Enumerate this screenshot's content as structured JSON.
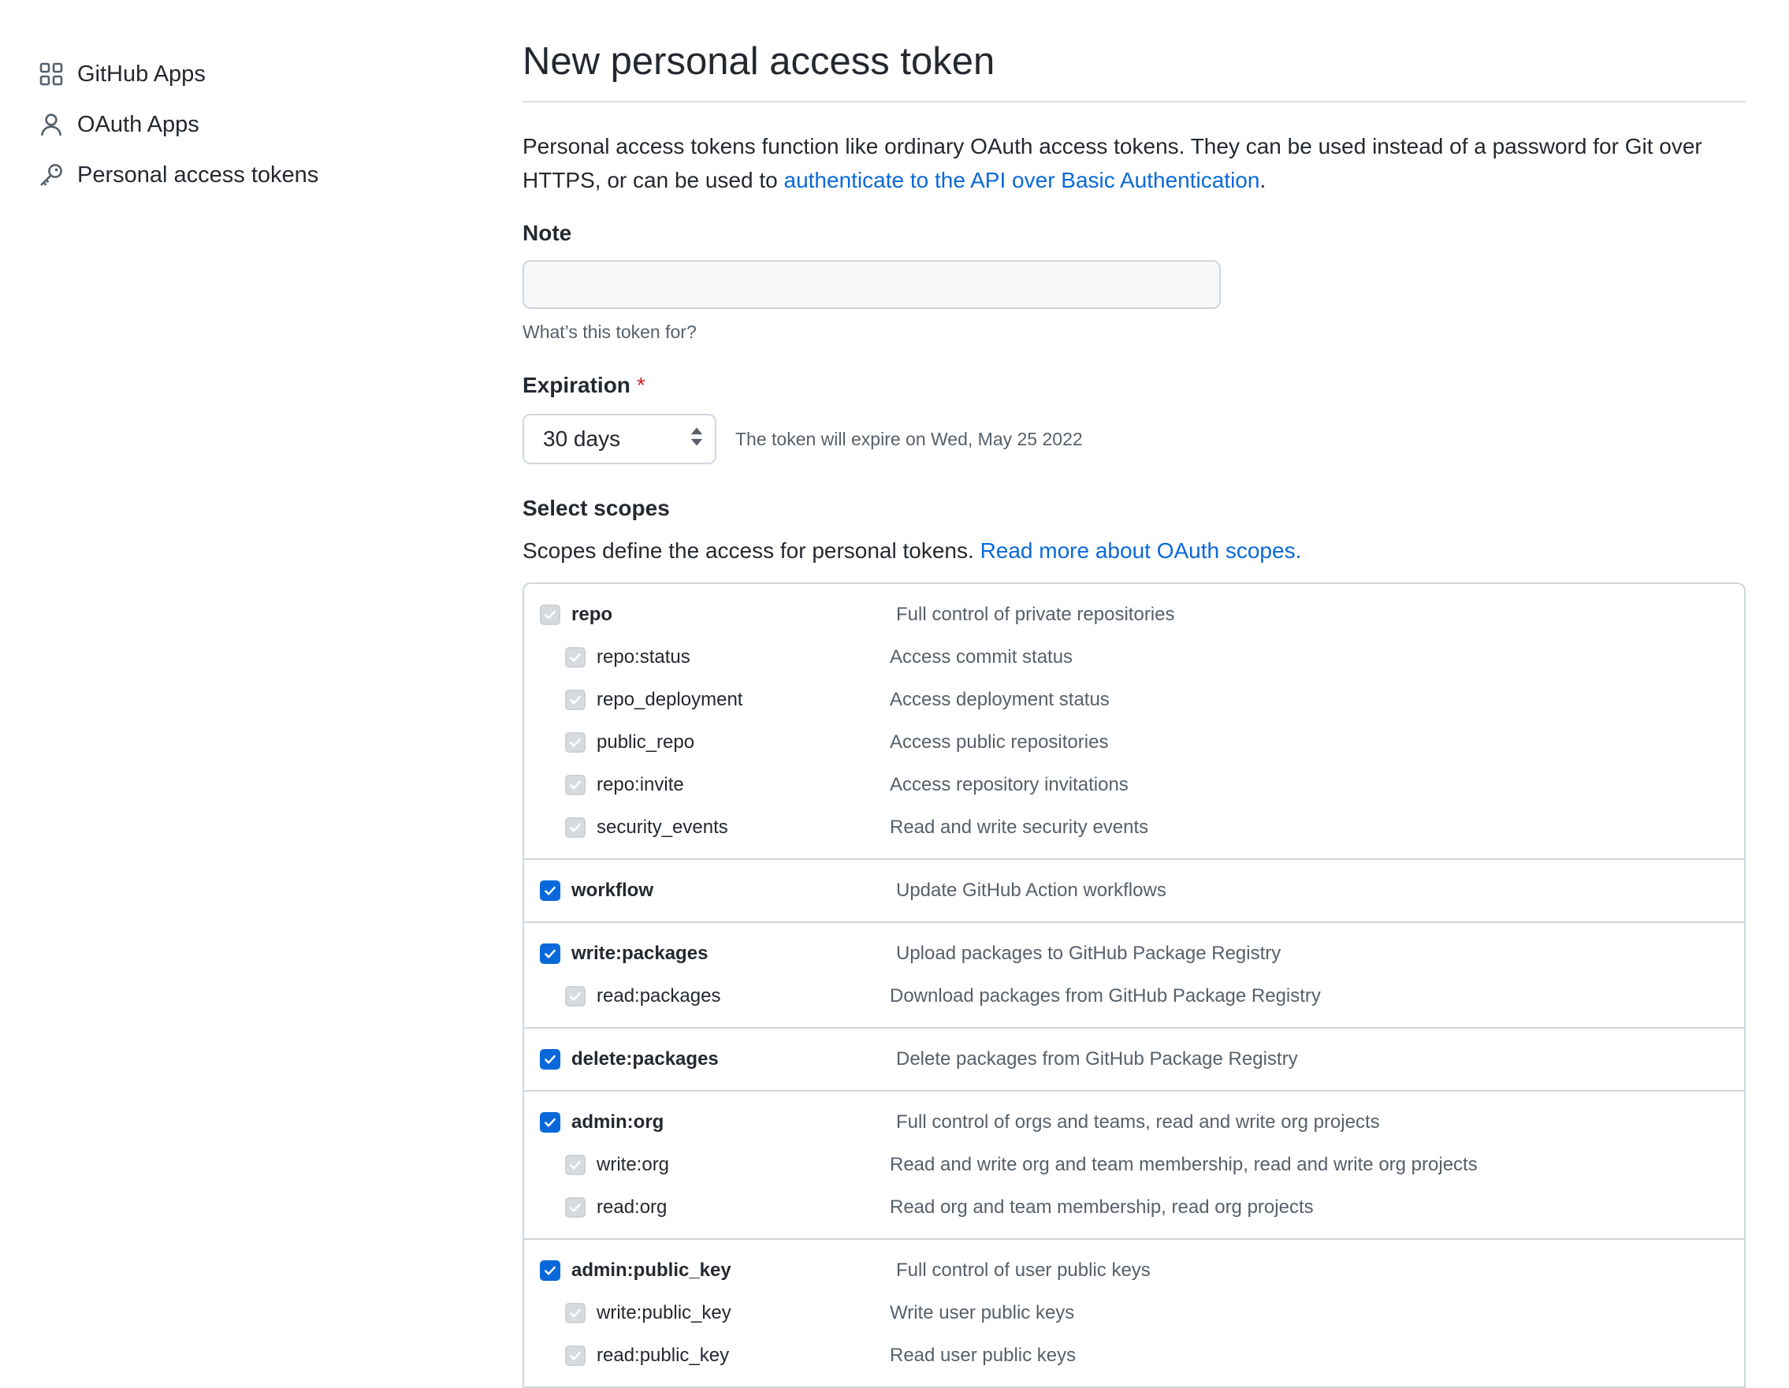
{
  "sidebar": {
    "items": [
      {
        "label": "GitHub Apps",
        "icon": "apps-grid-icon"
      },
      {
        "label": "OAuth Apps",
        "icon": "person-icon"
      },
      {
        "label": "Personal access tokens",
        "icon": "key-icon"
      }
    ]
  },
  "page": {
    "title": "New personal access token",
    "intro_text": "Personal access tokens function like ordinary OAuth access tokens. They can be used instead of a password for Git over HTTPS, or can be used to ",
    "intro_link": "authenticate to the API over Basic Authentication",
    "intro_end": "."
  },
  "note": {
    "label": "Note",
    "value": "",
    "help": "What’s this token for?"
  },
  "expiration": {
    "label": "Expiration",
    "required_mark": "*",
    "selected": "30 days",
    "info": "The token will expire on Wed, May 25 2022"
  },
  "scopes": {
    "label": "Select scopes",
    "desc": "Scopes define the access for personal tokens. ",
    "desc_link": "Read more about OAuth scopes.",
    "groups": [
      {
        "name": "repo",
        "desc": "Full control of private repositories",
        "checked": true,
        "disabled": true,
        "children": [
          {
            "name": "repo:status",
            "desc": "Access commit status"
          },
          {
            "name": "repo_deployment",
            "desc": "Access deployment status"
          },
          {
            "name": "public_repo",
            "desc": "Access public repositories"
          },
          {
            "name": "repo:invite",
            "desc": "Access repository invitations"
          },
          {
            "name": "security_events",
            "desc": "Read and write security events"
          }
        ]
      },
      {
        "name": "workflow",
        "desc": "Update GitHub Action workflows",
        "checked": true,
        "disabled": false,
        "children": []
      },
      {
        "name": "write:packages",
        "desc": "Upload packages to GitHub Package Registry",
        "checked": true,
        "disabled": false,
        "children": [
          {
            "name": "read:packages",
            "desc": "Download packages from GitHub Package Registry"
          }
        ]
      },
      {
        "name": "delete:packages",
        "desc": "Delete packages from GitHub Package Registry",
        "checked": true,
        "disabled": false,
        "children": []
      },
      {
        "name": "admin:org",
        "desc": "Full control of orgs and teams, read and write org projects",
        "checked": true,
        "disabled": false,
        "children": [
          {
            "name": "write:org",
            "desc": "Read and write org and team membership, read and write org projects"
          },
          {
            "name": "read:org",
            "desc": "Read org and team membership, read org projects"
          }
        ]
      },
      {
        "name": "admin:public_key",
        "desc": "Full control of user public keys",
        "checked": true,
        "disabled": false,
        "children": [
          {
            "name": "write:public_key",
            "desc": "Write user public keys"
          },
          {
            "name": "read:public_key",
            "desc": "Read user public keys"
          }
        ]
      }
    ]
  },
  "colors": {
    "accent": "#0969da",
    "required": "#cf222e",
    "muted_text": "#57606a",
    "border": "#d0d7de"
  }
}
